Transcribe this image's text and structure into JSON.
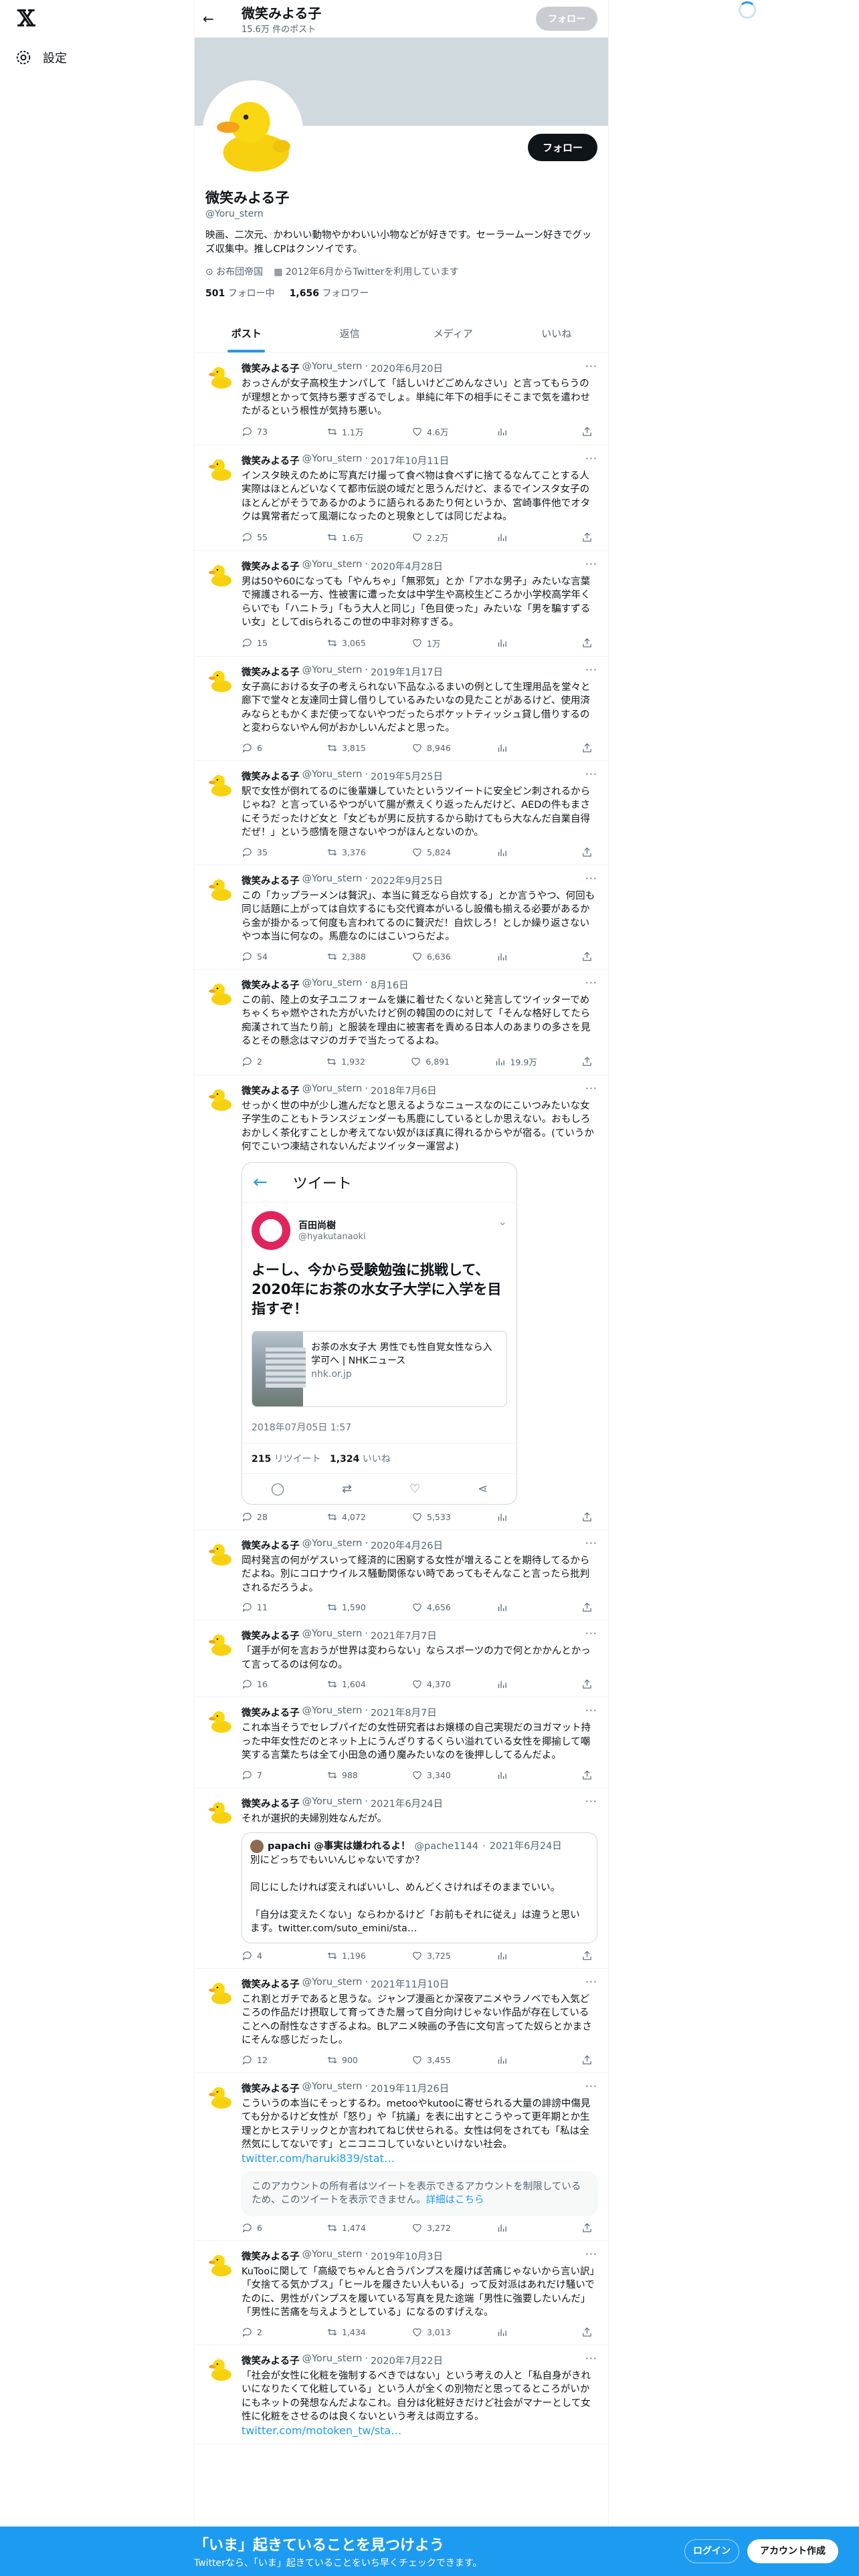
{
  "nav": {
    "logo": "𝕏",
    "settings_label": "設定"
  },
  "topbar": {
    "name": "微笑みよる子",
    "post_count": "15.6万 件のポスト",
    "follow_label": "フォロー"
  },
  "profile": {
    "name": "微笑みよる子",
    "handle": "@Yoru_stern",
    "follow_label": "フォロー",
    "bio": "映画、二次元、かわいい動物やかわいい小物などが好きです。セーラームーン好きでグッズ収集中。推しCPはクンソイです。",
    "location": "お布団帝国",
    "joined": "2012年6月からTwitterを利用しています",
    "following_count": "501",
    "following_label": "フォロー中",
    "followers_count": "1,656",
    "followers_label": "フォロワー"
  },
  "tabs": [
    "ポスト",
    "返信",
    "メディア",
    "いいね"
  ],
  "tweets": [
    {
      "name": "微笑みよる子",
      "handle": "@Yoru_stern",
      "date": "2020年6月20日",
      "text": "おっさんが女子高校生ナンパして「話しいけどごめんなさい」と言ってもらうのが理想とかって気持ち悪すぎるでしょ。単純に年下の相手にそこまで気を遣わせたがるという根性が気持ち悪い。",
      "replies": "73",
      "retweets": "1.1万",
      "likes": "4.6万",
      "views": ""
    },
    {
      "name": "微笑みよる子",
      "handle": "@Yoru_stern",
      "date": "2017年10月11日",
      "text": "インスタ映えのために写真だけ撮って食べ物は食べずに捨てるなんてことする人実際はほとんどいなくて都市伝説の域だと思うんだけど、まるでインスタ女子のほとんどがそうであるかのように語られるあたり何というか、宮崎事件他でオタクは異常者だって風潮になったのと現象としては同じだよね。",
      "replies": "55",
      "retweets": "1.6万",
      "likes": "2.2万",
      "views": ""
    },
    {
      "name": "微笑みよる子",
      "handle": "@Yoru_stern",
      "date": "2020年4月28日",
      "text": "男は50や60になっても「やんちゃ」「無邪気」とか「アホな男子」みたいな言葉で擁護される一方、性被害に遭った女は中学生や高校生どころか小学校高学年くらいでも「ハニトラ」「もう大人と同じ」「色目使った」みたいな「男を騙すずるい女」としてdisられるこの世の中非対称すぎる。",
      "replies": "15",
      "retweets": "3,065",
      "likes": "1万",
      "views": ""
    },
    {
      "name": "微笑みよる子",
      "handle": "@Yoru_stern",
      "date": "2019年1月17日",
      "text": "女子高における女子の考えられない下品なふるまいの例として生理用品を堂々と廊下で堂々と友達同士貸し借りしているみたいなの見たことがあるけど、使用済みならともかくまだ使ってないやつだったらポケットティッシュ貸し借りするのと変わらないやん何がおかしいんだよと思った。",
      "replies": "6",
      "retweets": "3,815",
      "likes": "8,946",
      "views": ""
    },
    {
      "name": "微笑みよる子",
      "handle": "@Yoru_stern",
      "date": "2019年5月25日",
      "text": "駅で女性が倒れてるのに後輩嫌していたというツイートに安全ピン刺されるからじゃね？と言っているやつがいて腸が煮えくり返ったんだけど、AEDの件もまさにそうだったけど女と「女どもが男に反抗するから助けてもら大なんだ自業自得だぜ！」という感情を隠さないやつがほんとないのか。",
      "replies": "35",
      "retweets": "3,376",
      "likes": "5,824",
      "views": ""
    },
    {
      "name": "微笑みよる子",
      "handle": "@Yoru_stern",
      "date": "2022年9月25日",
      "text": "この「カップラーメンは贅沢」、本当に貧乏なら自炊する」とか言うやつ、何回も同じ話題に上がっては自炊するにも交代資本がいるし設備も揃える必要があるから金が掛かるって何度も言われてるのに贅沢だ！自炊しろ！としか繰り返さないやつ本当に何なの。馬鹿なのにはこいつらだよ。",
      "replies": "54",
      "retweets": "2,388",
      "likes": "6,636",
      "views": ""
    },
    {
      "name": "微笑みよる子",
      "handle": "@Yoru_stern",
      "date": "8月16日",
      "text": "この前、陸上の女子ユニフォームを嫌に着せたくないと発言してツイッターでめちゃくちゃ燃やされた方がいたけど例の韓国ののに対して「そんな格好してたら痴漢されて当たり前」と服装を理由に被害者を責める日本人のあまりの多さを見るとその懸念はマジのガチで当たってるよね。",
      "replies": "2",
      "retweets": "1,932",
      "likes": "6,891",
      "views": "19.9万"
    },
    {
      "name": "微笑みよる子",
      "handle": "@Yoru_stern",
      "date": "2018年7月6日",
      "text": "せっかく世の中が少し進んだなと思えるようなニュースなのにこいつみたいな女子学生のこともトランスジェンダーも馬鹿にしているとしか思えない。おもしろおかしく茶化すことしか考えてない奴がほぼ真に得れるからやが宿る。(ていうか何でこいつ凍結されないんだよツイッター運営よ)",
      "replies": "28",
      "retweets": "4,072",
      "likes": "5,533",
      "views": ""
    },
    {
      "name": "微笑みよる子",
      "handle": "@Yoru_stern",
      "date": "2020年4月26日",
      "text": "岡村発言の何がゲスいって経済的に困窮する女性が増えることを期待してるからだよね。別にコロナウイルス騒動関係ない時であってもそんなこと言ったら批判されるだろうよ。",
      "replies": "11",
      "retweets": "1,590",
      "likes": "4,656",
      "views": ""
    },
    {
      "name": "微笑みよる子",
      "handle": "@Yoru_stern",
      "date": "2021年7月7日",
      "text": "「選手が何を言おうが世界は変わらない」ならスポーツの力で何とかかんとかって言ってるのは何なの。",
      "replies": "16",
      "retweets": "1,604",
      "likes": "4,370",
      "views": ""
    },
    {
      "name": "微笑みよる子",
      "handle": "@Yoru_stern",
      "date": "2021年8月7日",
      "text": "これ本当そうでセレブパイだの女性研究者はお嬢様の自己実現だのヨガマット持った中年女性だのとネット上にうんざりするくらい溢れている女性を揶揄して嘲笑する言葉たちは全て小田急の通り魔みたいなのを後押ししてるんだよ。",
      "replies": "7",
      "retweets": "988",
      "likes": "3,340",
      "views": ""
    },
    {
      "name": "微笑みよる子",
      "handle": "@Yoru_stern",
      "date": "2021年6月24日",
      "text": "それが選択的夫婦別姓なんだが。",
      "replies": "4",
      "retweets": "1,196",
      "likes": "3,725",
      "views": ""
    },
    {
      "name": "微笑みよる子",
      "handle": "@Yoru_stern",
      "date": "2021年11月10日",
      "text": "これ割とガチであると思うな。ジャンプ漫画とか深夜アニメやラノベでも入気どころの作品だけ摂取して育ってきた層って自分向けじゃない作品が存在していることへの耐性なさすぎるよね。BLアニメ映画の予告に文句言ってた奴らとかまさにそんな感じだったし。",
      "replies": "12",
      "retweets": "900",
      "likes": "3,455",
      "views": ""
    },
    {
      "name": "微笑みよる子",
      "handle": "@Yoru_stern",
      "date": "2019年11月26日",
      "text": "こういうの本当にそっとするわ。metooやkutooに寄せられる大量の誹謗中傷見ても分かるけど女性が「怒り」や「抗議」を表に出すとこうやって更年期とか生理とかヒステリックとか言われてねじ伏せられる。女性は何をされても「私は全然気にしてないです」とニコニコしていないといけない社会。",
      "link": "twitter.com/haruki839/stat…",
      "replies": "6",
      "retweets": "1,474",
      "likes": "3,272",
      "views": ""
    },
    {
      "name": "微笑みよる子",
      "handle": "@Yoru_stern",
      "date": "2019年10月3日",
      "text": "KuTooに関して「高級でちゃんと合うパンプスを履けば苦痛じゃないから言い訳」「女捨てる気かブス」「ヒールを履きたい人もいる」って反対派はあれだけ騒いでたのに、男性がパンプスを履いている写真を見た途端「男性に強要したいんだ」「男性に苦痛を与えようとしている」になるのすげえな。",
      "replies": "2",
      "retweets": "1,434",
      "likes": "3,013",
      "views": ""
    },
    {
      "name": "微笑みよる子",
      "handle": "@Yoru_stern",
      "date": "2020年7月22日",
      "text": "「社会が女性に化粧を強制するべきではない」という考えの人と「私自身がきれいになりたくて化粧している」という人が全くの別物だと思ってるところがいかにもネットの発想なんだよなこれ。自分は化粧好きだけど社会がマナーとして女性に化粧をさせるのは良くないという考えは両立する。",
      "link": "twitter.com/motoken_tw/sta…",
      "replies": "",
      "retweets": "",
      "likes": "",
      "views": ""
    }
  ],
  "embed": {
    "header": "ツイート",
    "user_name": "百田尚樹",
    "user_handle": "@hyakutanaoki",
    "text": "よーし、今から受験勉強に挑戦して、2020年にお茶の水女子大学に入学を目指すぞ！",
    "card_title": "お茶の水女子大 男性でも性自覚女性なら入学可へ | NHKニュース",
    "card_domain": "nhk.or.jp",
    "date": "2018年07月05日 1:57",
    "retweets_count": "215",
    "retweets_label": "リツイート",
    "likes_count": "1,324",
    "likes_label": "いいね"
  },
  "quote": {
    "name": "papachi @事実は嫌われるよ！",
    "handle": "@pache1144",
    "date": "2021年6月24日",
    "line1": "別にどっちでもいいんじゃないですか？",
    "line2": "同じにしたければ変えればいいし、めんどくさければそのままでいい。",
    "line3": "「自分は変えたくない」ならわかるけど「お前もそれに従え」は違うと思います。twitter.com/suto_emini/sta…"
  },
  "notice": {
    "text": "このアカウントの所有者はツイートを表示できるアカウントを制限しているため、このツイートを表示できません。",
    "link": "詳細はこちら"
  },
  "bottom": {
    "title": "「いま」起きていることを見つけよう",
    "subtitle": "Twitterなら、「いま」起きていることをいち早くチェックできます。",
    "login": "ログイン",
    "signup": "アカウント作成"
  },
  "colors": {
    "accent": "#1d9bf0",
    "text": "#0f1419",
    "muted": "#536471"
  }
}
